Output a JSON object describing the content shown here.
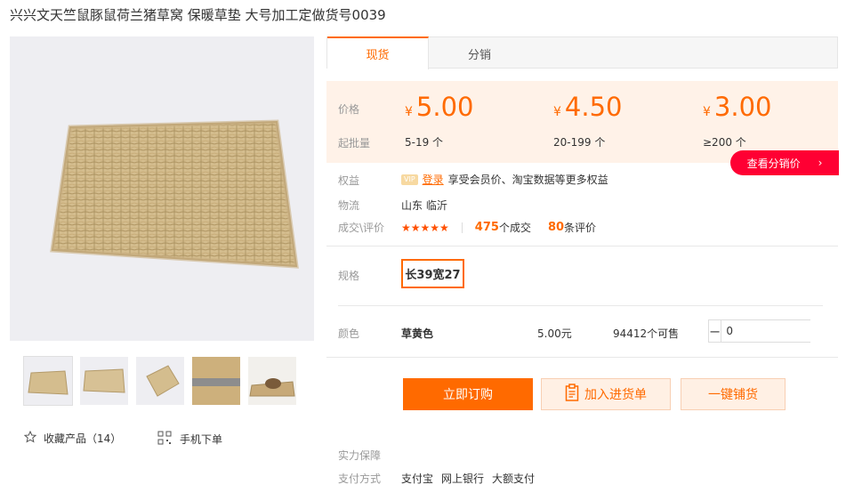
{
  "product": {
    "title": "兴兴文天竺鼠豚鼠荷兰猪草窝 保暖草垫 大号加工定做货号0039"
  },
  "gallery": {
    "thumb_count": 5,
    "selected_thumb": 0
  },
  "favorites": {
    "label": "收藏产品（14）"
  },
  "mobile_order": {
    "label": "手机下单"
  },
  "tabs": [
    {
      "label": "现货",
      "active": true
    },
    {
      "label": "分销",
      "active": false
    }
  ],
  "price": {
    "price_label": "价格",
    "batch_label": "起批量",
    "currency": "¥",
    "tiers": [
      {
        "price": "5.00",
        "qty": "5-19 个"
      },
      {
        "price": "4.50",
        "qty": "20-199 个"
      },
      {
        "price": "3.00",
        "qty": "≥200 个"
      }
    ],
    "accent_color": "#ff6a00"
  },
  "distribution_button": {
    "label": "查看分销价",
    "arrow": "›"
  },
  "rights": {
    "label": "权益",
    "vip_badge": "VIP",
    "login_label": "登录",
    "text": "享受会员价、淘宝数据等更多权益"
  },
  "logistics": {
    "label": "物流",
    "value": "山东 临沂"
  },
  "trade": {
    "label": "成交\\评价",
    "stars": "★★★★★",
    "deal_count": "475",
    "deal_suffix": "个成交",
    "review_count": "80",
    "review_suffix": "条评价"
  },
  "spec": {
    "label": "规格",
    "option": "长39宽27"
  },
  "color": {
    "label": "颜色",
    "name": "草黄色",
    "price": "5.00元",
    "stock": "94412个可售",
    "quantity": "0",
    "minus": "−",
    "plus": "+"
  },
  "actions": {
    "order_label": "立即订购",
    "cart_label": "加入进货单",
    "oneclick_label": "一键铺货"
  },
  "guarantee": {
    "label": "实力保障"
  },
  "payment": {
    "label": "支付方式",
    "methods": [
      "支付宝",
      "网上银行",
      "大额支付"
    ]
  }
}
